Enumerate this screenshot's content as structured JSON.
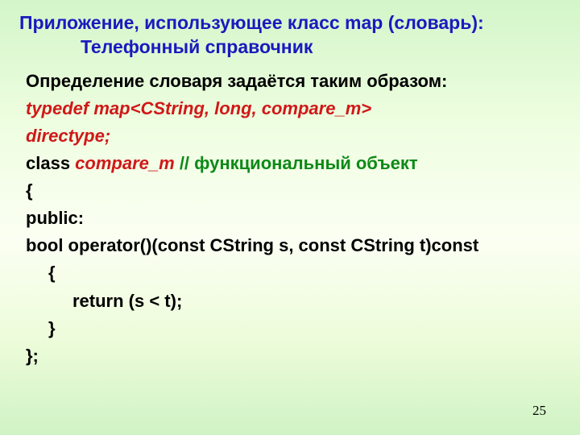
{
  "title": {
    "line1": "Приложение,  использующее класс map  (словарь):",
    "line2": "Телефонный справочник"
  },
  "body": {
    "intro": "Определение словаря задаётся таким образом:",
    "typedef": {
      "kw": "typedef map",
      "tpl": "<CString, long, compare_m>",
      "kw2": "directype;"
    },
    "classline": {
      "kw": "class ",
      "name": "compare_m",
      "gap": "   ",
      "comment": "// функциональный объект"
    },
    "l_open": "{",
    "l_public": "public:",
    "l_op": "bool operator()(const CString s, const CString t)const",
    "l_open2": "{",
    "l_return": "return (s < t);",
    "l_close2": "}",
    "l_close": "};"
  },
  "page": "25"
}
